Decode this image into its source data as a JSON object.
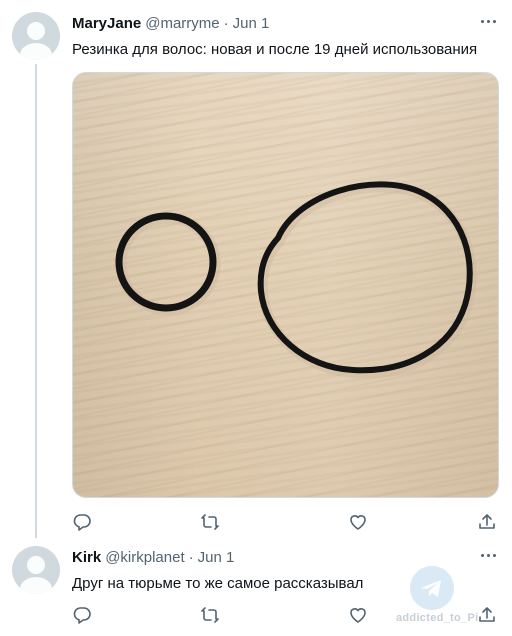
{
  "tweets": [
    {
      "name": "MaryJane",
      "handle": "@marryme",
      "separator": "·",
      "date": "Jun 1",
      "text": "Резинка для волос: новая и после 19 дней использования",
      "avatar_icon": "default-avatar-icon",
      "photo_description_icon": "two-hair-ties-photo"
    },
    {
      "name": "Kirk",
      "handle": "@kirkplanet",
      "separator": "·",
      "date": "Jun 1",
      "text": "Друг на тюрьме то же самое рассказывал",
      "avatar_icon": "default-avatar-icon"
    }
  ],
  "action_icons": [
    "reply-icon",
    "retweet-icon",
    "like-icon",
    "share-icon"
  ],
  "watermark": {
    "text": "addicted_to_Pi",
    "icon": "telegram-icon"
  },
  "colors": {
    "text_primary": "#0f1419",
    "text_secondary": "#536471",
    "divider": "#cfd9de",
    "watermark": "#c7cfd6"
  }
}
